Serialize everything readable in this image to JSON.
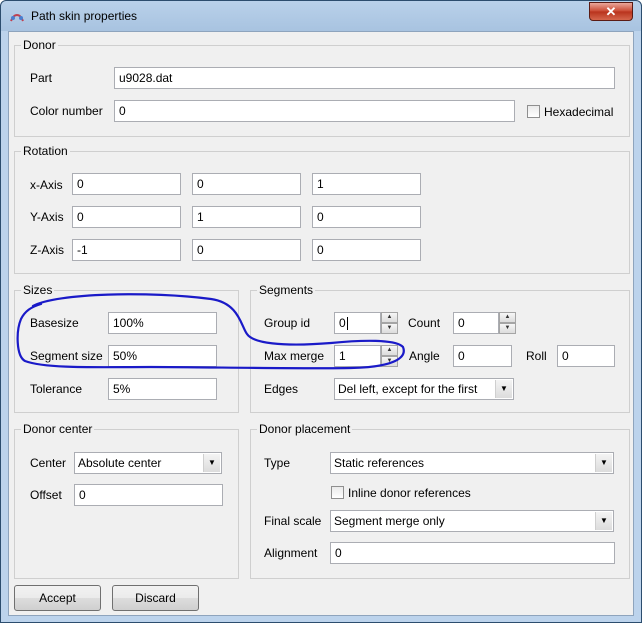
{
  "window": {
    "title": "Path skin properties",
    "close_label": "✕"
  },
  "donor": {
    "group_label": "Donor",
    "part_label": "Part",
    "part_value": "u9028.dat",
    "color_label": "Color number",
    "color_value": "0",
    "hex_label": "Hexadecimal",
    "hex_checked": false
  },
  "rotation": {
    "group_label": "Rotation",
    "rows": [
      {
        "label": "x-Axis",
        "values": [
          "0",
          "0",
          "1"
        ]
      },
      {
        "label": "Y-Axis",
        "values": [
          "0",
          "1",
          "0"
        ]
      },
      {
        "label": "Z-Axis",
        "values": [
          "-1",
          "0",
          "0"
        ]
      }
    ]
  },
  "sizes": {
    "group_label": "Sizes",
    "basesize_label": "Basesize",
    "basesize_value": "100%",
    "segment_size_label": "Segment size",
    "segment_size_value": "50%",
    "tolerance_label": "Tolerance",
    "tolerance_value": "5%"
  },
  "segments": {
    "group_label": "Segments",
    "group_id_label": "Group id",
    "group_id_value": "0",
    "count_label": "Count",
    "count_value": "0",
    "max_merge_label": "Max merge",
    "max_merge_value": "1",
    "angle_label": "Angle",
    "angle_value": "0",
    "roll_label": "Roll",
    "roll_value": "0",
    "edges_label": "Edges",
    "edges_value": "Del left, except for the first"
  },
  "donor_center": {
    "group_label": "Donor center",
    "center_label": "Center",
    "center_value": "Absolute center",
    "offset_label": "Offset",
    "offset_value": "0"
  },
  "donor_placement": {
    "group_label": "Donor placement",
    "type_label": "Type",
    "type_value": "Static references",
    "inline_label": "Inline donor references",
    "inline_checked": false,
    "final_scale_label": "Final scale",
    "final_scale_value": "Segment merge only",
    "alignment_label": "Alignment",
    "alignment_value": "0"
  },
  "buttons": {
    "accept": "Accept",
    "discard": "Discard"
  },
  "colors": {
    "annotation": "#1a1ac8",
    "title_bar": "#b9d1ea",
    "close_button": "#c9462f"
  },
  "icons": {
    "app": "path-skin-app-icon",
    "close": "close-icon",
    "spin_up": "spin-up-icon",
    "spin_down": "spin-down-icon",
    "dropdown": "chevron-down-icon"
  }
}
